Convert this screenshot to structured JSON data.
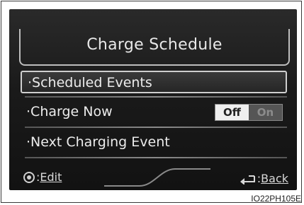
{
  "screen": {
    "title": "Charge Schedule",
    "items": [
      {
        "label": "Scheduled Events"
      },
      {
        "label": "Charge Now"
      },
      {
        "label": "Next Charging Event"
      }
    ],
    "charge_now_toggle": {
      "off_label": "Off",
      "on_label": "On",
      "state": "Off"
    }
  },
  "footer": {
    "edit_prefix": ":",
    "edit_label": "Edit",
    "back_prefix": ":",
    "back_label": "Back"
  },
  "caption": "IO22PH105E",
  "colors": {
    "screen_bg": "#1a1a1a",
    "text": "#ececec",
    "toggle_selected": "#efefef",
    "toggle_unselected": "#555555"
  }
}
